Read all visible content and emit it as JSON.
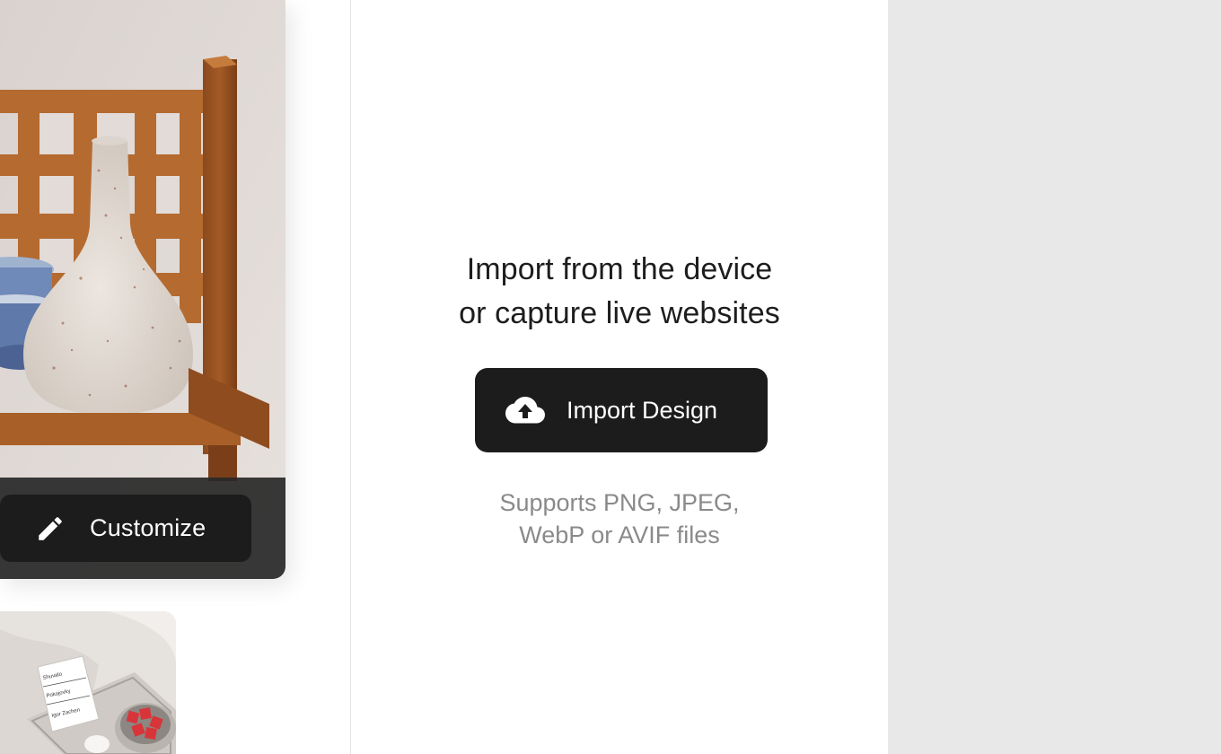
{
  "gallery": {
    "primary_card": {
      "customize_label": "Customize",
      "icon": "pencil-icon"
    },
    "secondary_card": {
      "book_lines": [
        "Shuvalo",
        "Pokojovky",
        "Igor Zachen"
      ]
    }
  },
  "import_panel": {
    "title_line1": "Import from the device",
    "title_line2": "or capture live websites",
    "button_label": "Import Design",
    "button_icon": "cloud-upload-icon",
    "hint_line1": "Supports PNG, JPEG,",
    "hint_line2": "WebP or AVIF files"
  },
  "colors": {
    "button_bg": "#1c1c1c",
    "button_text": "#ffffff",
    "title_text": "#1d1d1d",
    "hint_text": "#8a8a8a",
    "right_area_bg": "#e8e8e8"
  }
}
